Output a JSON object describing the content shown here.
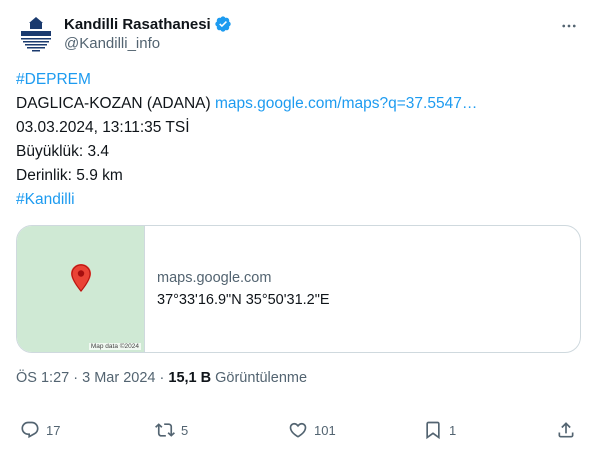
{
  "author": {
    "display_name": "Kandilli Rasathanesi",
    "handle": "@Kandilli_info",
    "avatar_text": "KANDILLI",
    "verified": true,
    "verified_color": "#1d9bf0"
  },
  "tweet": {
    "hashtag_top": "#DEPREM",
    "location": "DAGLICA-KOZAN (ADANA)",
    "location_link": "maps.google.com/maps?q=37.5547…",
    "datetime": "03.03.2024, 13:11:35 TSİ",
    "magnitude": "Büyüklük: 3.4",
    "depth": "Derinlik: 5.9 km",
    "hashtag_bottom": "#Kandilli"
  },
  "card": {
    "map_credit": "Map data ©2024",
    "domain": "maps.google.com",
    "title": "37°33'16.9\"N 35°50'31.2\"E",
    "pin_icon": "map-pin-icon",
    "pin_color": "#ea4335",
    "map_color": "#cfe9d4"
  },
  "meta": {
    "time": "ÖS 1:27",
    "separator": "·",
    "date": "3 Mar 2024",
    "views_count": "15,1 B",
    "views_label": "Görüntülenme"
  },
  "actions": {
    "reply_icon": "reply-icon",
    "reply_count": "17",
    "retweet_icon": "retweet-icon",
    "retweet_count": "5",
    "like_icon": "heart-icon",
    "like_count": "101",
    "bookmark_icon": "bookmark-icon",
    "bookmark_count": "1",
    "share_icon": "share-icon"
  },
  "colors": {
    "link": "#1d9bf0",
    "text": "#0f1419",
    "secondary": "#536471",
    "border": "#cfd9de"
  }
}
